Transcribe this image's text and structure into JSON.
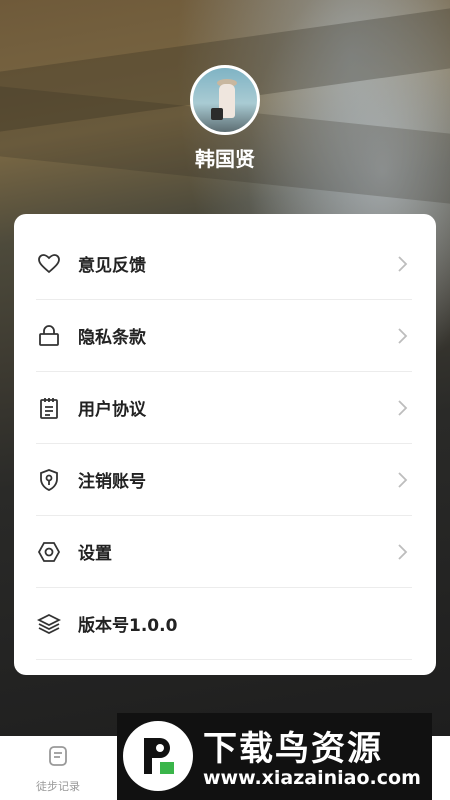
{
  "profile": {
    "name": "韩国贤"
  },
  "menu": [
    {
      "label": "意见反馈",
      "icon": "heart-icon"
    },
    {
      "label": "隐私条款",
      "icon": "lock-icon"
    },
    {
      "label": "用户协议",
      "icon": "notepad-icon"
    },
    {
      "label": "注销账号",
      "icon": "shield-key-icon"
    },
    {
      "label": "设置",
      "icon": "hexagon-settings-icon"
    },
    {
      "label": "版本号1.0.0",
      "icon": "layers-icon"
    }
  ],
  "tabbar": {
    "tab1": {
      "label": "徒步记录",
      "icon": "record-icon"
    }
  },
  "watermark": {
    "title": "下载鸟资源",
    "url": "www.xiazainiao.com"
  },
  "colors": {
    "card": "#ffffff",
    "text": "#222222",
    "icon": "#333333",
    "divider": "#ececec"
  }
}
